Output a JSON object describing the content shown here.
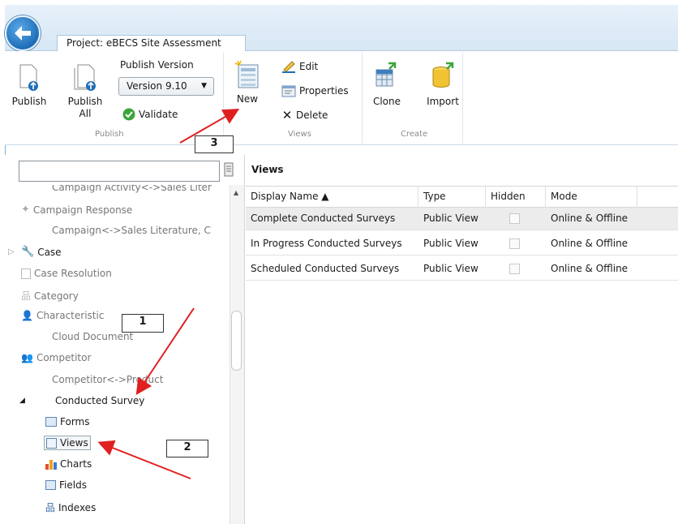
{
  "project_tab": "Project: eBECS Site Assessment",
  "publish_group": {
    "publish_label": "Publish",
    "publish_all_label_1": "Publish",
    "publish_all_label_2": "All",
    "publish_version_label": "Publish Version",
    "version_value": "Version 9.10",
    "validate_label": "Validate",
    "group_label": "Publish"
  },
  "views_group": {
    "new_label": "New",
    "edit_label": "Edit",
    "properties_label": "Properties",
    "delete_label": "Delete",
    "group_label": "Views"
  },
  "create_group": {
    "clone_label": "Clone",
    "import_label": "Import",
    "group_label": "Create"
  },
  "search": {
    "placeholder": ""
  },
  "nav": {
    "items": [
      {
        "label": "Campaign Activity<->Sales Liter",
        "style": "gray"
      },
      {
        "label": "Campaign Response",
        "style": "gray"
      },
      {
        "label": "Campaign<->Sales Literature, C",
        "style": "gray"
      },
      {
        "label": "Case",
        "style": "normal"
      },
      {
        "label": "Case Resolution",
        "style": "gray"
      },
      {
        "label": "Category",
        "style": "gray"
      },
      {
        "label": "Characteristic",
        "style": "gray"
      },
      {
        "label": "Cloud Document",
        "style": "gray"
      },
      {
        "label": "Competitor",
        "style": "gray"
      },
      {
        "label": "Competitor<->Product",
        "style": "gray"
      },
      {
        "label": "Conducted Survey",
        "style": "normal"
      },
      {
        "label": "Forms",
        "style": "normal"
      },
      {
        "label": "Views",
        "style": "normal"
      },
      {
        "label": "Charts",
        "style": "normal"
      },
      {
        "label": "Fields",
        "style": "normal"
      },
      {
        "label": "Indexes",
        "style": "normal"
      }
    ]
  },
  "views_panel": {
    "title": "Views",
    "columns": [
      "Display Name ▲",
      "Type",
      "Hidden",
      "Mode"
    ],
    "rows": [
      {
        "name": "Complete Conducted Surveys",
        "type": "Public View",
        "mode": "Online & Offline"
      },
      {
        "name": "In Progress Conducted Surveys",
        "type": "Public View",
        "mode": "Online & Offline"
      },
      {
        "name": "Scheduled Conducted Surveys",
        "type": "Public View",
        "mode": "Online & Offline"
      }
    ]
  },
  "annotations": {
    "one": "1",
    "two": "2",
    "three": "3"
  },
  "colors": {
    "arrow": "#e02020",
    "accent": "#1f6db8"
  }
}
